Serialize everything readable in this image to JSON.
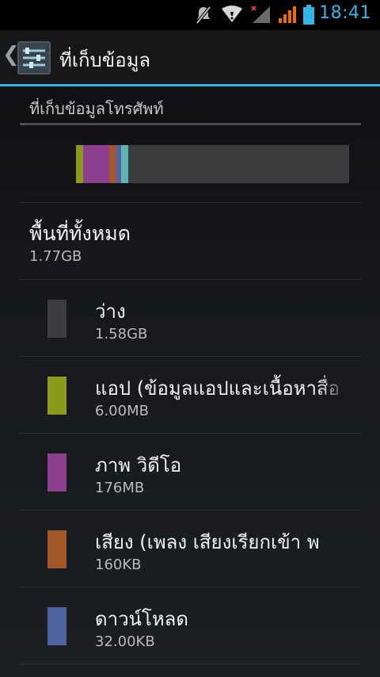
{
  "status_bar": {
    "time": "18:41",
    "icons": [
      "mute-icon",
      "wifi-icon",
      "no-signal-icon",
      "signal-icon",
      "battery-icon"
    ],
    "accent_color": "#33b5e5"
  },
  "action_bar": {
    "title": "ที่เก็บข้อมูล",
    "app_icon": "settings-sliders-icon",
    "up_icon": "chevron-left-icon"
  },
  "storage": {
    "section_title": "ที่เก็บข้อมูลโทรศัพท์",
    "usage_segments": [
      {
        "name": "apps",
        "color": "#8b9a1a",
        "fraction": 0.026
      },
      {
        "name": "pictures-video",
        "color": "#8c3e8f",
        "fraction": 0.095
      },
      {
        "name": "audio",
        "color": "#a0572a",
        "fraction": 0.026
      },
      {
        "name": "downloads",
        "color": "#4f63a0",
        "fraction": 0.017
      },
      {
        "name": "misc",
        "color": "#5fb3b3",
        "fraction": 0.026
      },
      {
        "name": "free",
        "color": "#3b3c3e",
        "fraction": 0.81
      }
    ],
    "total": {
      "label": "พื้นที่ทั้งหมด",
      "value": "1.77GB"
    },
    "items": [
      {
        "label": "ว่าง",
        "value": "1.58GB",
        "color": "#3b3c3e"
      },
      {
        "label": "แอป (ข้อมูลแอปและเนื้อหาสื่อ",
        "value": "6.00MB",
        "color": "#8b9a1a"
      },
      {
        "label": "ภาพ วิดีโอ",
        "value": "176MB",
        "color": "#8c3e8f"
      },
      {
        "label": "เสียง (เพลง เสียงเรียกเข้า พ",
        "value": "160KB",
        "color": "#a0572a"
      },
      {
        "label": "ดาวน์โหลด",
        "value": "32.00KB",
        "color": "#4f63a0"
      }
    ]
  }
}
